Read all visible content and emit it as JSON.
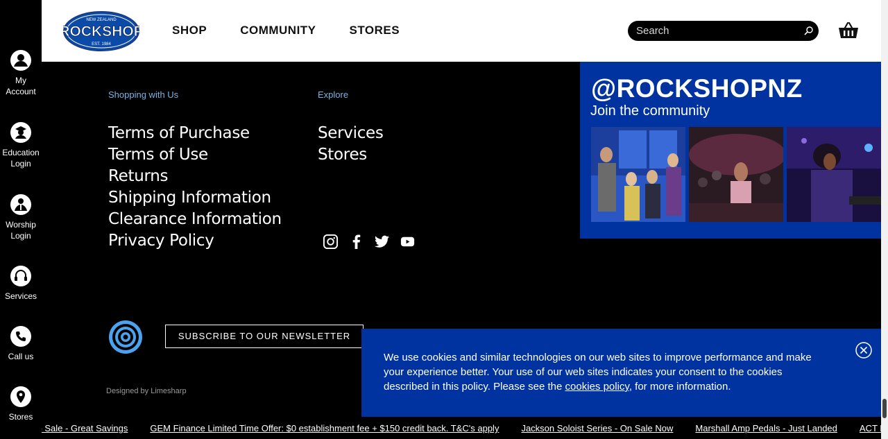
{
  "sidebar": {
    "items": [
      {
        "label_1": "My",
        "label_2": "Account",
        "icon": "user-icon"
      },
      {
        "label_1": "Education",
        "label_2": "Login",
        "icon": "graduate-icon"
      },
      {
        "label_1": "Worship",
        "label_2": "Login",
        "icon": "worship-icon"
      },
      {
        "label_1": "Services",
        "label_2": "",
        "icon": "headset-icon"
      },
      {
        "label_1": "Call us",
        "label_2": "",
        "icon": "phone-icon"
      },
      {
        "label_1": "Stores",
        "label_2": "",
        "icon": "map-pin-icon"
      }
    ]
  },
  "header": {
    "logo": {
      "top_text": "NEW ZEALAND",
      "brand": "ROCKSHOP",
      "bottom_text": "EST. 1984"
    },
    "nav": [
      "SHOP",
      "COMMUNITY",
      "STORES"
    ],
    "search_placeholder": "Search"
  },
  "footer": {
    "shopping": {
      "heading": "Shopping with Us",
      "links": [
        "Terms of Purchase",
        "Terms of Use",
        "Returns",
        "Shipping Information",
        "Clearance Information",
        "Privacy Policy"
      ]
    },
    "explore": {
      "heading": "Explore",
      "links": [
        "Services",
        "Stores"
      ]
    },
    "socials": [
      "instagram-icon",
      "facebook-icon",
      "twitter-icon",
      "youtube-icon"
    ],
    "newsletter_button": "SUBSCRIBE TO OUR NEWSLETTER",
    "credit": "Designed by Limesharp"
  },
  "instagram": {
    "handle": "@ROCKSHOPNZ",
    "subtitle": "Join the community"
  },
  "cookie_banner": {
    "text_before": "We use cookies and similar technologies on our web sites to improve performance and make your experience better. Your use of our web sites indicates your consent to the cookies described in this policy. Please see the ",
    "link": "cookies policy",
    "text_after": ", for more information."
  },
  "ticker": [
    "Tube Amp Sale - Great Savings",
    "GEM Finance Limited Time Offer: $0 establishment fee + $150 credit back. T&C's apply",
    "Jackson Soloist Series - On Sale Now",
    "Marshall Amp Pedals - Just Landed",
    "ACT F"
  ],
  "colors": {
    "brand_blue": "#0033a0",
    "heading_blue": "#7db3e3"
  }
}
